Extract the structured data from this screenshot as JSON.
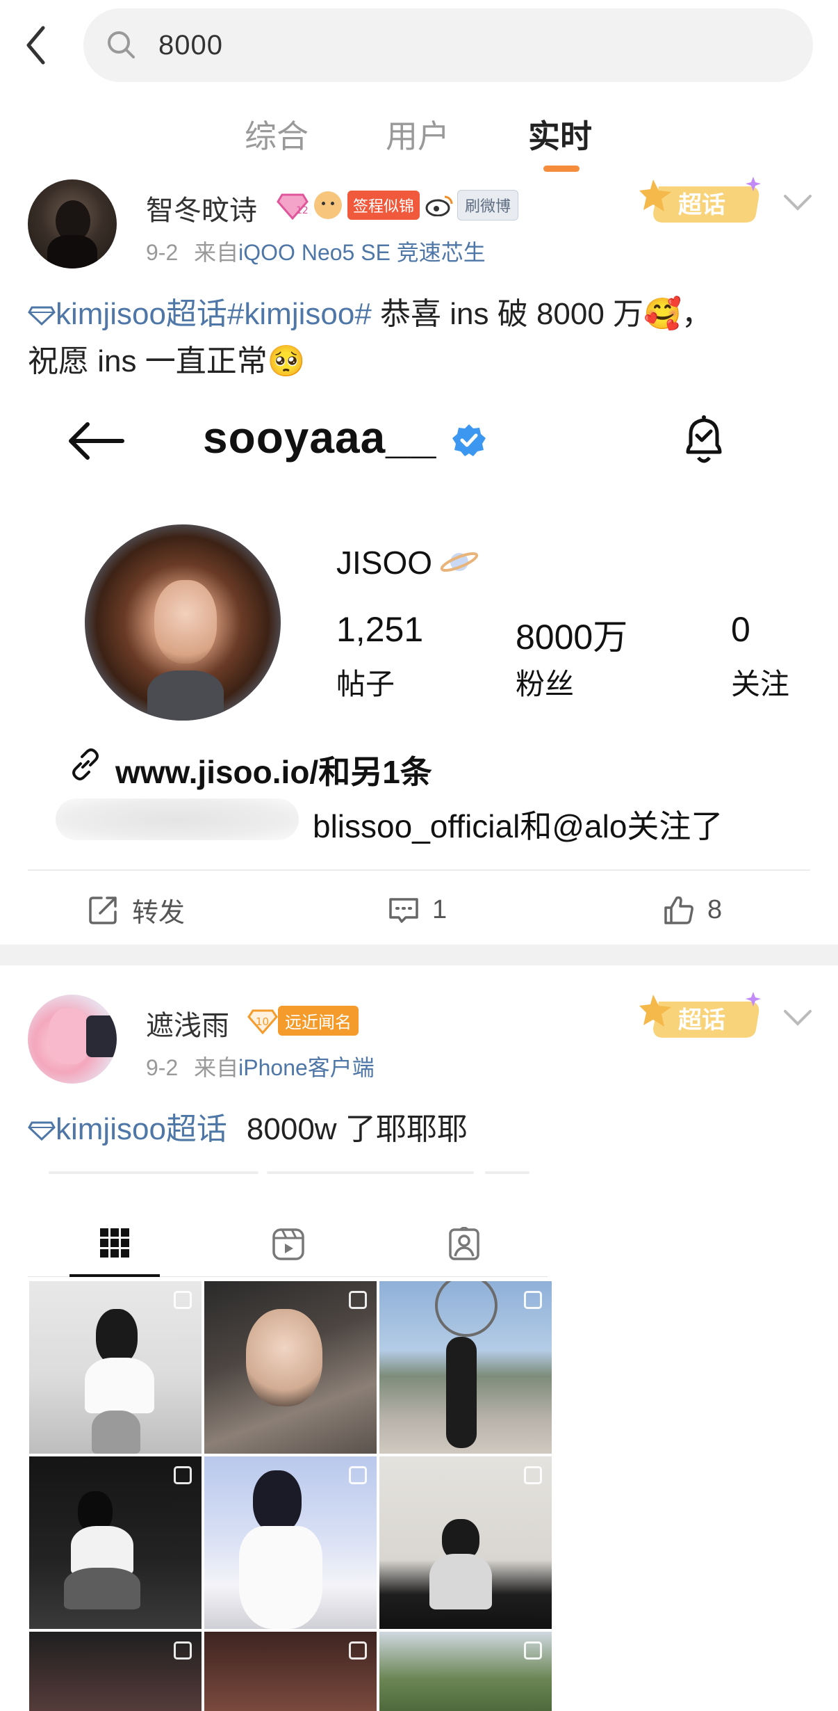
{
  "search": {
    "query": "8000"
  },
  "tabs": [
    {
      "label": "综合"
    },
    {
      "label": "用户"
    },
    {
      "label": "实时",
      "active": true
    }
  ],
  "colors": {
    "accent": "#f58c3c",
    "link": "#4e77a8",
    "badge_red": "#f0593b",
    "badge_orange": "#f49b2c"
  },
  "posts": [
    {
      "author": "智冬旼诗",
      "badges": {
        "level": "12",
        "title": "签程似锦",
        "weibo": "刷微博"
      },
      "date": "9-2",
      "source_prefix": "来自",
      "source": "iQOO Neo5 SE 竞速芯生",
      "supertopic_label": "超话",
      "text_line1_topic": "kimjisoo超话",
      "text_line1_tag": "#kimjisoo#",
      "text_line1_rest": " 恭喜 ins 破 8000 万",
      "text_line1_emoji": "🥰",
      "text_line1_end": "，",
      "text_line2": "祝愿 ins 一直正常",
      "text_line2_emoji": "🥺",
      "actions": {
        "repost": "转发",
        "comments": "1",
        "likes": "8"
      }
    },
    {
      "author": "遮浅雨",
      "badges": {
        "level": "10",
        "title": "远近闻名"
      },
      "date": "9-2",
      "source_prefix": "来自",
      "source": "iPhone客户端",
      "supertopic_label": "超话",
      "text_topic": "kimjisoo超话",
      "text_rest": "8000w 了耶耶耶"
    }
  ],
  "instagram": {
    "handle": "sooyaaa__",
    "display_name": "JISOO",
    "stats": [
      {
        "value": "1,251",
        "label": "帖子"
      },
      {
        "value": "8000万",
        "label": "粉丝"
      },
      {
        "value": "0",
        "label": "关注"
      }
    ],
    "link": "www.jisoo.io/和另1条",
    "followed_by": "blissoo_official和@alo关注了"
  }
}
